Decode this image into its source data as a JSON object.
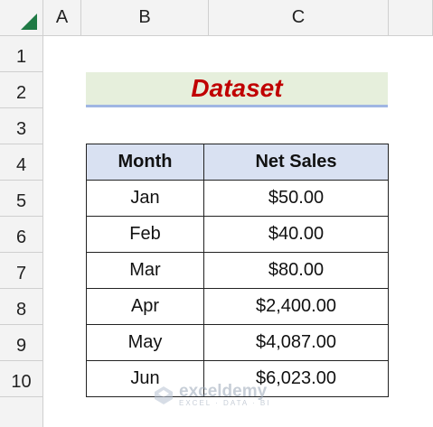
{
  "columns": [
    "A",
    "B",
    "C"
  ],
  "rows": [
    "1",
    "2",
    "3",
    "4",
    "5",
    "6",
    "7",
    "8",
    "9",
    "10"
  ],
  "title": "Dataset",
  "table": {
    "headers": [
      "Month",
      "Net Sales"
    ],
    "rows": [
      [
        "Jan",
        "$50.00"
      ],
      [
        "Feb",
        "$40.00"
      ],
      [
        "Mar",
        "$80.00"
      ],
      [
        "Apr",
        "$2,400.00"
      ],
      [
        "May",
        "$4,087.00"
      ],
      [
        "Jun",
        "$6,023.00"
      ]
    ]
  },
  "watermark": {
    "name": "exceldemy",
    "tagline": "EXCEL · DATA · BI"
  },
  "colors": {
    "title_text": "#c00000",
    "title_fill": "#e6efdc",
    "header_fill": "#d9e1f2",
    "corner_triangle": "#1f7a45"
  }
}
